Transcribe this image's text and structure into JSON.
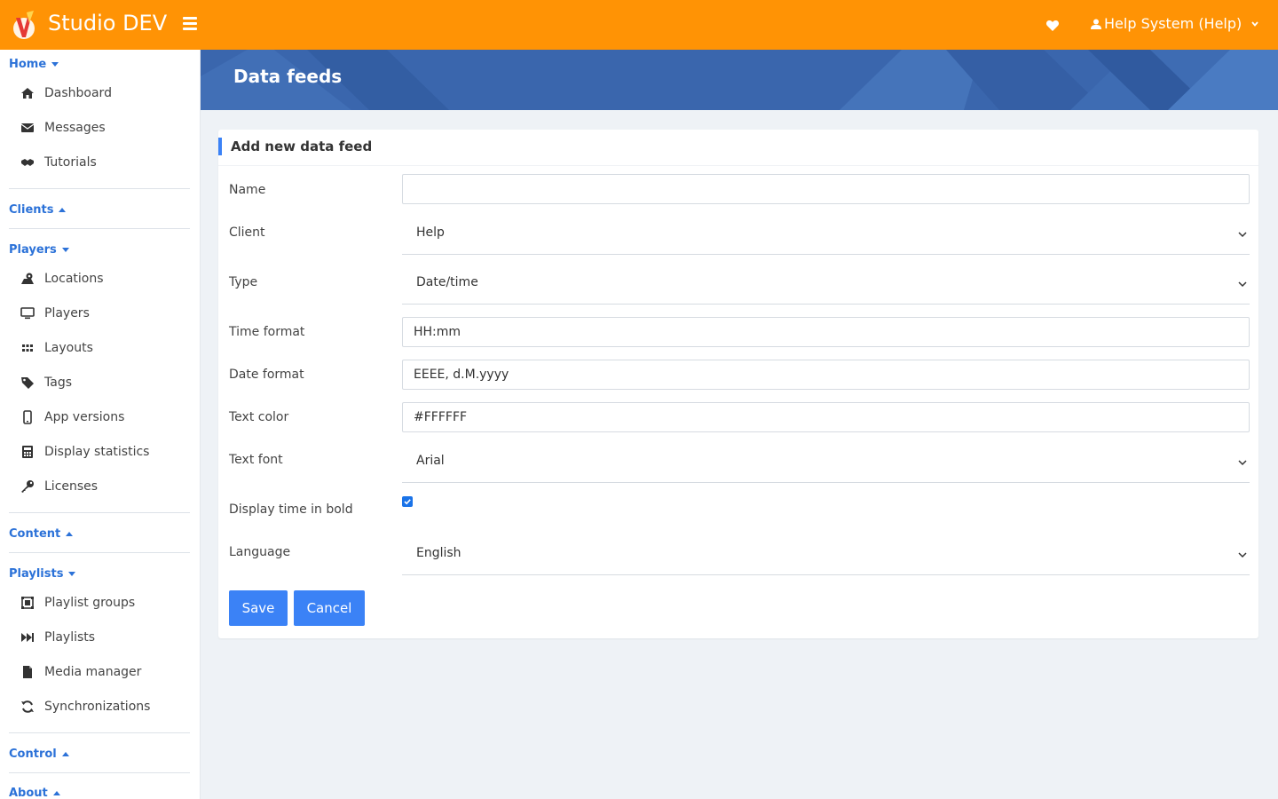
{
  "app": {
    "brand": "Studio DEV",
    "user_label": "Help System (Help)",
    "accent_color": "#ff9305",
    "link_color": "#2c72d8"
  },
  "sidebar": {
    "sections": [
      {
        "label": "Home",
        "expanded": true,
        "items": [
          {
            "label": "Dashboard",
            "icon": "home-icon"
          },
          {
            "label": "Messages",
            "icon": "envelope-icon"
          },
          {
            "label": "Tutorials",
            "icon": "handshake-icon"
          }
        ]
      },
      {
        "label": "Clients",
        "expanded": false,
        "items": []
      },
      {
        "label": "Players",
        "expanded": true,
        "items": [
          {
            "label": "Locations",
            "icon": "map-marker-icon"
          },
          {
            "label": "Players",
            "icon": "monitor-icon"
          },
          {
            "label": "Layouts",
            "icon": "grid-icon"
          },
          {
            "label": "Tags",
            "icon": "tag-icon"
          },
          {
            "label": "App versions",
            "icon": "mobile-icon"
          },
          {
            "label": "Display statistics",
            "icon": "calculator-icon"
          },
          {
            "label": "Licenses",
            "icon": "key-icon"
          }
        ]
      },
      {
        "label": "Content",
        "expanded": false,
        "items": []
      },
      {
        "label": "Playlists",
        "expanded": true,
        "items": [
          {
            "label": "Playlist groups",
            "icon": "object-group-icon"
          },
          {
            "label": "Playlists",
            "icon": "fast-forward-icon"
          },
          {
            "label": "Media manager",
            "icon": "file-icon"
          },
          {
            "label": "Synchronizations",
            "icon": "sync-icon"
          }
        ]
      },
      {
        "label": "Control",
        "expanded": false,
        "items": []
      },
      {
        "label": "About",
        "expanded": false,
        "items": []
      }
    ]
  },
  "page": {
    "title": "Data feeds"
  },
  "form": {
    "title": "Add new data feed",
    "name": {
      "label": "Name",
      "value": ""
    },
    "client": {
      "label": "Client",
      "value": "Help"
    },
    "type": {
      "label": "Type",
      "value": "Date/time"
    },
    "time_format": {
      "label": "Time format",
      "value": "HH:mm"
    },
    "date_format": {
      "label": "Date format",
      "value": "EEEE, d.M.yyyy"
    },
    "text_color": {
      "label": "Text color",
      "value": "#FFFFFF"
    },
    "text_font": {
      "label": "Text font",
      "value": "Arial"
    },
    "bold": {
      "label": "Display time in bold",
      "checked": true
    },
    "language": {
      "label": "Language",
      "value": "English"
    },
    "save_label": "Save",
    "cancel_label": "Cancel"
  }
}
